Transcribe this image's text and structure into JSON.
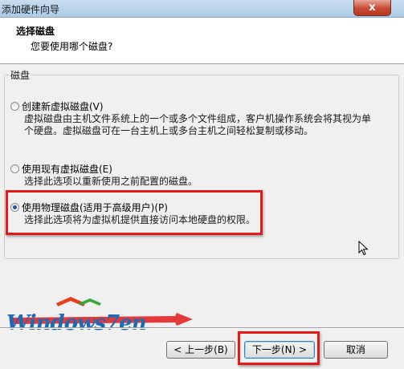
{
  "window": {
    "title": "添加硬件向导",
    "close_label": "x"
  },
  "header": {
    "title": "选择磁盘",
    "subtitle": "您要使用哪个磁盘?"
  },
  "group": {
    "legend": "磁盘"
  },
  "options": [
    {
      "label": "创建新虚拟磁盘(V)",
      "desc_line1": "虚拟磁盘由主机文件系统上的一个或多个文件组成，客户机操作系统会将其视为单",
      "desc_line2": "个硬盘。虚拟磁盘可在一台主机上或多台主机之间轻松复制或移动。",
      "checked": false
    },
    {
      "label": "使用现有虚拟磁盘(E)",
      "desc_line1": "选择此选项以重新使用之前配置的磁盘。",
      "checked": false
    },
    {
      "label": "使用物理磁盘(适用于高级用户)(P)",
      "desc_line1": "选择此选项将为虚拟机提供直接访问本地硬盘的权限。",
      "checked": true
    }
  ],
  "watermark": {
    "text": "Windows7en"
  },
  "buttons": {
    "back": "< 上一步(B)",
    "next": "下一步(N) >",
    "cancel": "取消"
  },
  "colors": {
    "highlight": "#e21a1a",
    "accent": "#1f57a5"
  }
}
